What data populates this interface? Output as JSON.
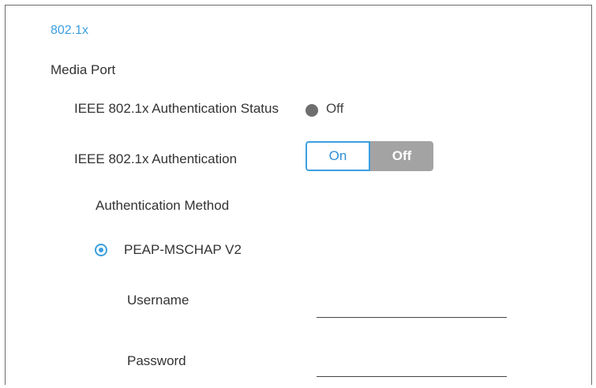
{
  "section": {
    "title": "802.1x"
  },
  "group": {
    "title": "Media Port"
  },
  "status": {
    "label": "IEEE 802.1x Authentication Status",
    "value": "Off",
    "indicator_color": "#6e6e6e"
  },
  "authentication": {
    "label": "IEEE 802.1x Authentication",
    "on_label": "On",
    "off_label": "Off",
    "selected": "Off"
  },
  "method": {
    "title": "Authentication Method",
    "options": [
      {
        "label": "PEAP-MSCHAP V2",
        "selected": true
      }
    ]
  },
  "fields": {
    "username": {
      "label": "Username",
      "value": ""
    },
    "password": {
      "label": "Password",
      "value": ""
    }
  },
  "colors": {
    "accent": "#3b9fe0",
    "toggle_off_bg": "#a3a3a3",
    "text": "#333333"
  }
}
